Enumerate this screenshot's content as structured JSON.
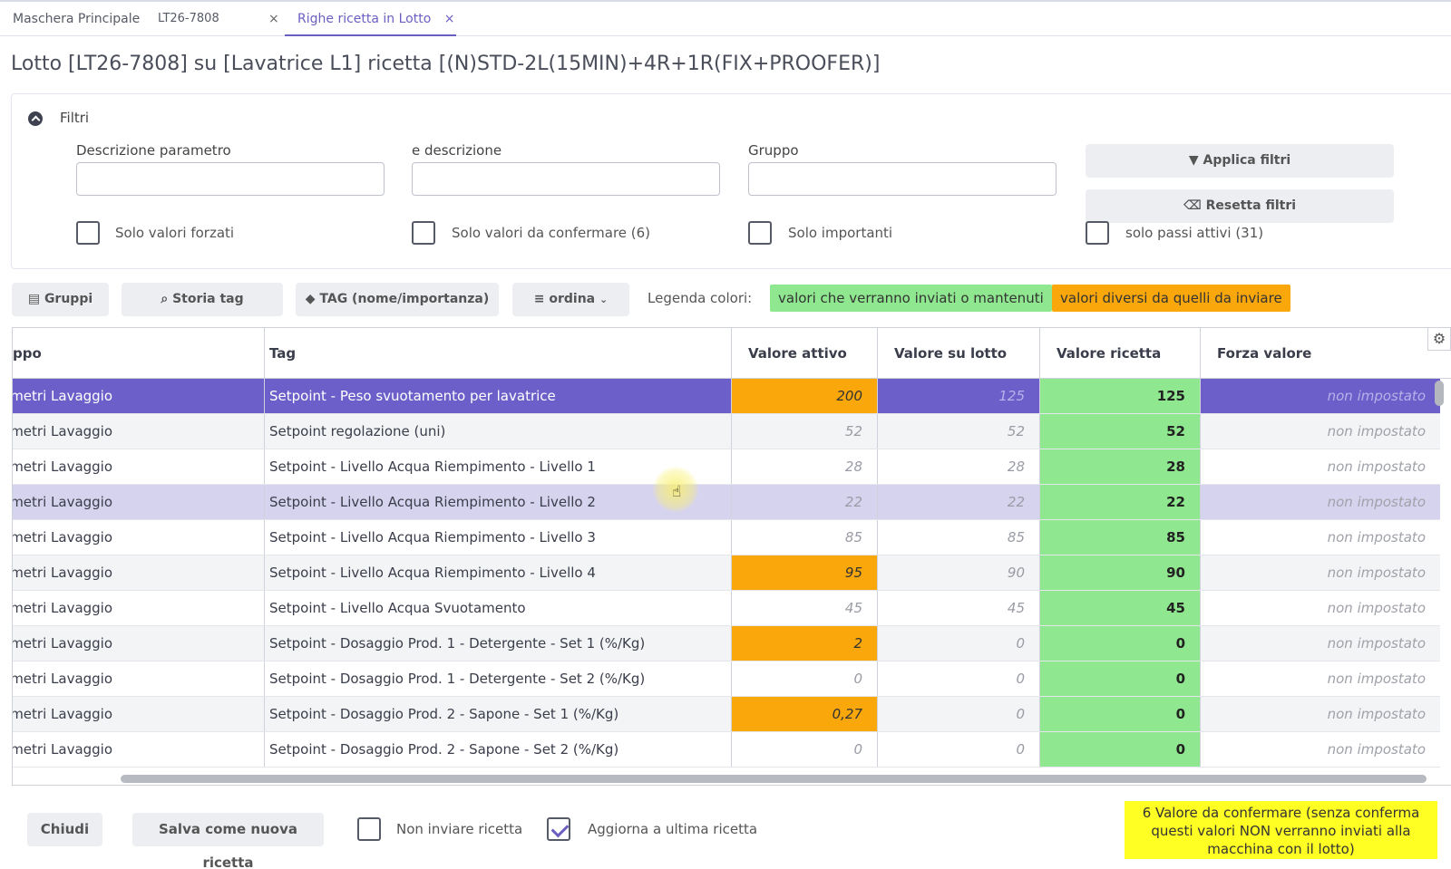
{
  "tabs": [
    {
      "label": "Maschera Principale"
    },
    {
      "label": "LT26-7808",
      "close": "×"
    },
    {
      "label": "Righe ricetta in Lotto",
      "close": "×"
    }
  ],
  "page_title": "Lotto [LT26-7808] su [Lavatrice L1] ricetta [(N)STD-2L(15MIN)+4R+1R(FIX+PROOFER)]",
  "filters": {
    "title": "Filtri",
    "desc_label": "Descrizione parametro",
    "desc_value": "",
    "e_desc_label": "e descrizione",
    "e_desc_value": "",
    "gruppo_label": "Gruppo",
    "gruppo_value": "",
    "apply_label": "Applica filtri",
    "reset_label": "Resetta filtri",
    "chk_forzati": "Solo valori forzati",
    "chk_confermare": "Solo valori da confermare (6)",
    "chk_importanti": "Solo importanti",
    "chk_passi": "solo passi attivi (31)"
  },
  "toolbar": {
    "gruppi": "Gruppi",
    "storia_tag": "Storia tag",
    "tag": "TAG (nome/importanza)",
    "ordina": "ordina",
    "legend_label": "Legenda colori:",
    "legend_green": "valori che verranno inviati o mantenuti",
    "legend_orange": "valori diversi da quelli da inviare",
    "legend_green_color": "#8fe88f",
    "legend_orange_color": "#f9a70b"
  },
  "grid": {
    "headers": {
      "gruppo": "ppo",
      "tag": "Tag",
      "valore_attivo": "Valore attivo",
      "valore_lotto": "Valore su lotto",
      "valore_ricetta": "Valore ricetta",
      "forza": "Forza valore"
    },
    "rows": [
      {
        "gruppo": "ametri Lavaggio",
        "tag": "Setpoint - Peso svuotamento per lavatrice",
        "attivo": "200",
        "lotto": "125",
        "ricetta": "125",
        "forza": "non impostato"
      },
      {
        "gruppo": "ametri Lavaggio",
        "tag": "Setpoint regolazione (uni)",
        "attivo": "52",
        "lotto": "52",
        "ricetta": "52",
        "forza": "non impostato"
      },
      {
        "gruppo": "ametri Lavaggio",
        "tag": "Setpoint - Livello Acqua Riempimento - Livello 1",
        "attivo": "28",
        "lotto": "28",
        "ricetta": "28",
        "forza": "non impostato"
      },
      {
        "gruppo": "ametri Lavaggio",
        "tag": "Setpoint - Livello Acqua Riempimento - Livello 2",
        "attivo": "22",
        "lotto": "22",
        "ricetta": "22",
        "forza": "non impostato"
      },
      {
        "gruppo": "ametri Lavaggio",
        "tag": "Setpoint - Livello Acqua Riempimento - Livello 3",
        "attivo": "85",
        "lotto": "85",
        "ricetta": "85",
        "forza": "non impostato"
      },
      {
        "gruppo": "ametri Lavaggio",
        "tag": "Setpoint - Livello Acqua Riempimento - Livello 4",
        "attivo": "95",
        "lotto": "90",
        "ricetta": "90",
        "forza": "non impostato"
      },
      {
        "gruppo": "ametri Lavaggio",
        "tag": "Setpoint - Livello Acqua Svuotamento",
        "attivo": "45",
        "lotto": "45",
        "ricetta": "45",
        "forza": "non impostato"
      },
      {
        "gruppo": "ametri Lavaggio",
        "tag": "Setpoint - Dosaggio Prod. 1 - Detergente - Set 1 (%/Kg)",
        "attivo": "2",
        "lotto": "0",
        "ricetta": "0",
        "forza": "non impostato"
      },
      {
        "gruppo": "ametri Lavaggio",
        "tag": "Setpoint - Dosaggio Prod. 1 - Detergente - Set 2 (%/Kg)",
        "attivo": "0",
        "lotto": "0",
        "ricetta": "0",
        "forza": "non impostato"
      },
      {
        "gruppo": "ametri Lavaggio",
        "tag": "Setpoint - Dosaggio Prod. 2 - Sapone - Set 1 (%/Kg)",
        "attivo": "0,27",
        "lotto": "0",
        "ricetta": "0",
        "forza": "non impostato"
      },
      {
        "gruppo": "ametri Lavaggio",
        "tag": "Setpoint - Dosaggio Prod. 2 - Sapone - Set 2 (%/Kg)",
        "attivo": "0",
        "lotto": "0",
        "ricetta": "0",
        "forza": "non impostato"
      }
    ]
  },
  "footer": {
    "chiudi": "Chiudi",
    "salva": "Salva come nuova ricetta",
    "non_inviare": "Non inviare ricetta",
    "aggiorna": "Aggiorna a ultima ricetta",
    "warning": "6 Valore da confermare (senza conferma questi valori NON verranno inviati alla macchina con il lotto)"
  }
}
